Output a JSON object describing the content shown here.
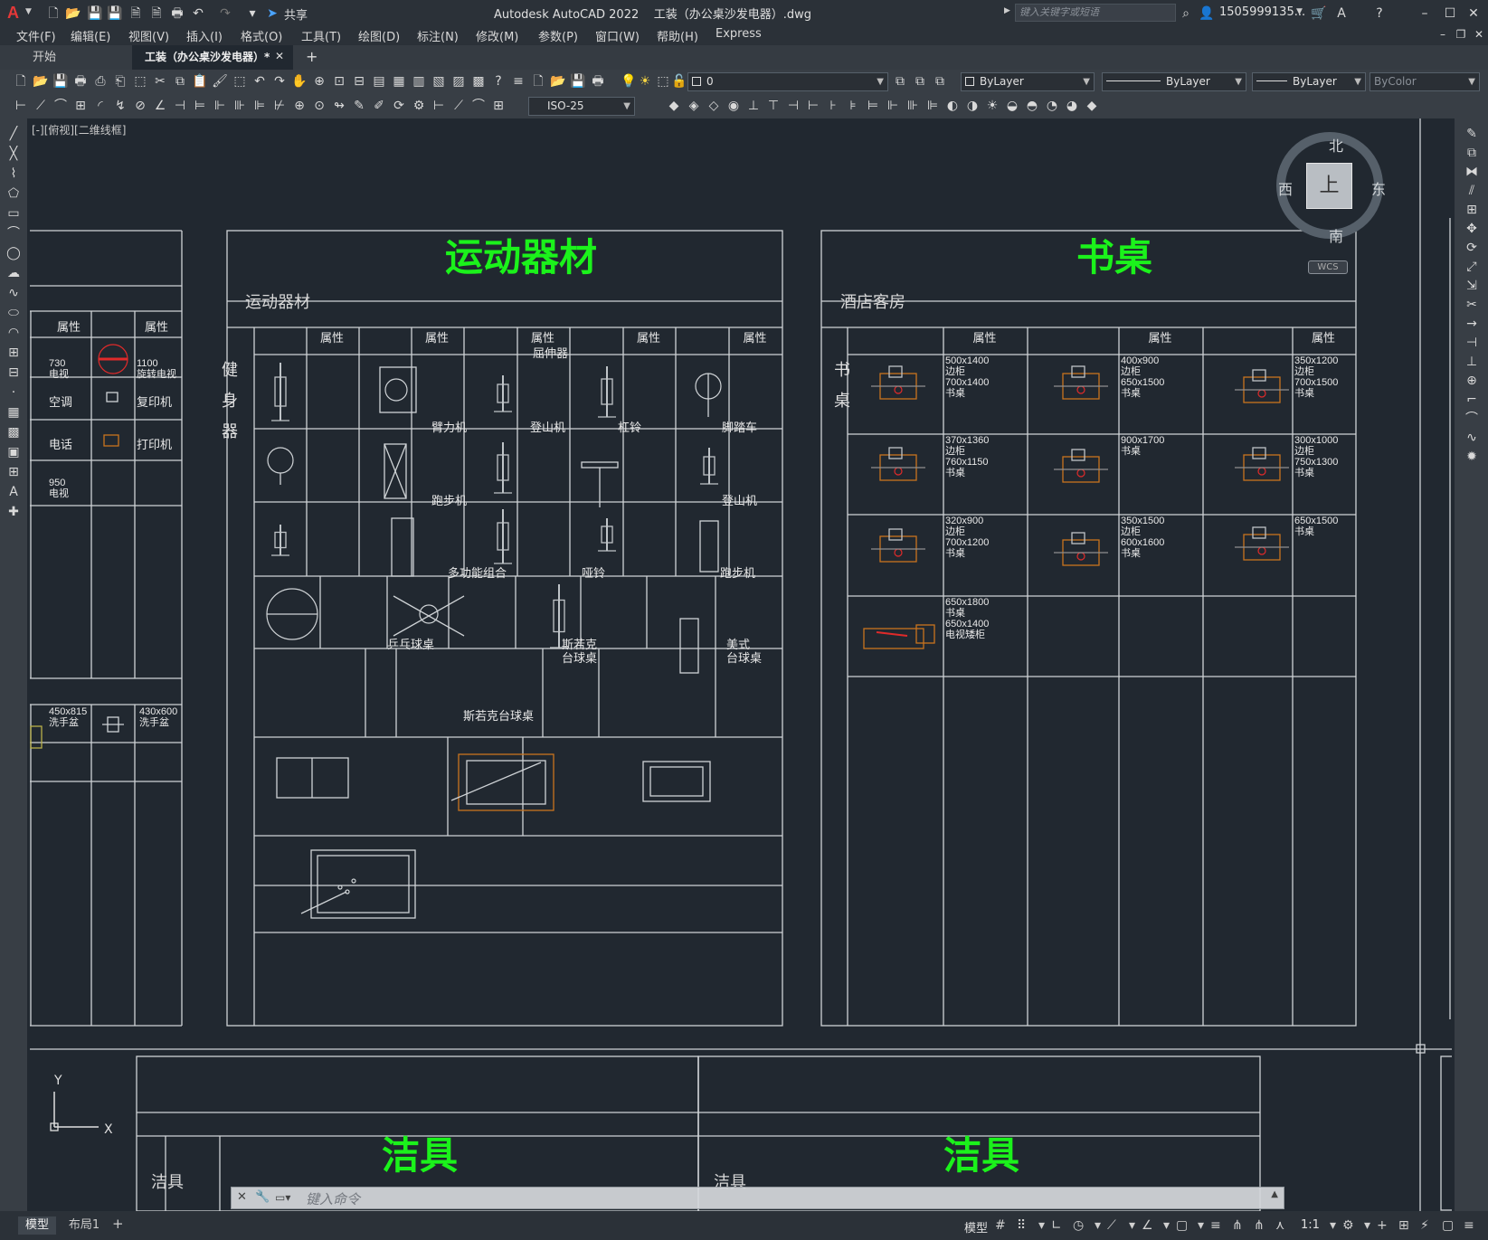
{
  "app": {
    "title": "Autodesk AutoCAD 2022    工装（办公桌沙发电器）.dwg",
    "share_label": "共享",
    "search_placeholder": "键入关键字或短语",
    "user": "1505999135...",
    "logo": "A"
  },
  "menu": [
    "文件(F)",
    "编辑(E)",
    "视图(V)",
    "插入(I)",
    "格式(O)",
    "工具(T)",
    "绘图(D)",
    "标注(N)",
    "修改(M)",
    "参数(P)",
    "窗口(W)",
    "帮助(H)",
    "Express"
  ],
  "tabs": [
    {
      "label": "开始"
    },
    {
      "label": "工装（办公桌沙发电器）*"
    }
  ],
  "toolbar": {
    "layer_value": "0",
    "color_value": "ByLayer",
    "linetype_value": "ByLayer",
    "lineweight_value": "ByLayer",
    "plotstyle_value": "ByColor",
    "dimstyle_value": "ISO-25"
  },
  "viewport": {
    "label": "[-][俯视][二维线框]"
  },
  "viewcube": {
    "north": "北",
    "south": "南",
    "east": "东",
    "west": "西",
    "top": "上",
    "wcs": "WCS"
  },
  "ucs": {
    "x": "X",
    "y": "Y"
  },
  "drawing": {
    "left_panel": {
      "headers": [
        "属性",
        "属性"
      ],
      "cells": [
        [
          "730\n电视",
          "1100\n旋转电视"
        ],
        [
          "空调",
          "复印机"
        ],
        [
          "电话",
          "打印机"
        ],
        [
          "950\n电视",
          ""
        ],
        [
          "450x815\n洗手盆",
          "430x600\n洗手盆"
        ]
      ]
    },
    "sports": {
      "title": "运动器材",
      "subtitle": "运动器材",
      "row_label": "健身器",
      "header": "属性",
      "labels": [
        "屈伸器",
        "臂力机",
        "登山机",
        "杠铃",
        "脚踏车",
        "跑步机",
        "登山机",
        "多功能组合",
        "哑铃",
        "跑步机",
        "乒乓球桌",
        "斯若克\n台球桌",
        "美式\n台球桌",
        "斯若克台球桌"
      ]
    },
    "desk": {
      "title": "书桌",
      "subtitle": "酒店客房",
      "row_label": "书桌",
      "header": "属性",
      "labels": [
        "500x1400\n边柜\n700x1400\n书桌",
        "400x900\n边柜\n650x1500\n书桌",
        "350x1200\n边柜\n700x1500\n书桌",
        "370x1360\n边柜\n760x1150\n书桌",
        "900x1700\n书桌",
        "300x1000\n边柜\n750x1300\n书桌",
        "320x900\n边柜\n700x1200\n书桌",
        "350x1500\n边柜\n600x1600\n书桌",
        "650x1500\n书桌",
        "650x1800\n书桌\n650x1400\n电视矮柜"
      ]
    },
    "clean1": {
      "title": "洁具",
      "subtitle": "洁具"
    },
    "clean2": {
      "title": "洁具",
      "subtitle": "洁具"
    }
  },
  "command": {
    "placeholder": "键入命令"
  },
  "layout_tabs": [
    "模型",
    "布局1"
  ],
  "status": {
    "model": "模型",
    "scale": "1:1"
  },
  "colors": {
    "title_green": "#1bf21b",
    "line": "#cfd3d6",
    "bg": "#212830",
    "accent_red": "#e02a2a",
    "accent_orange": "#c8741e"
  }
}
